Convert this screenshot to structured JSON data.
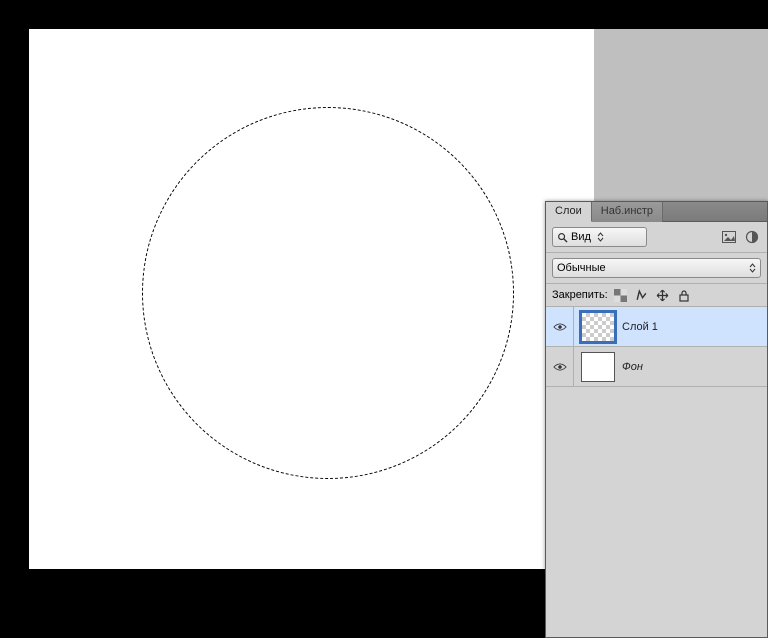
{
  "panel": {
    "tabs": [
      {
        "label": "Слои",
        "active": true
      },
      {
        "label": "Наб.инстр",
        "active": false
      }
    ],
    "filter": {
      "label": "Вид"
    },
    "blendMode": {
      "label": "Обычные"
    },
    "lock": {
      "label": "Закрепить:"
    },
    "layers": [
      {
        "name": "Слой 1",
        "selected": true,
        "transparent": true,
        "italic": false
      },
      {
        "name": "Фон",
        "selected": false,
        "transparent": false,
        "italic": true
      }
    ]
  }
}
